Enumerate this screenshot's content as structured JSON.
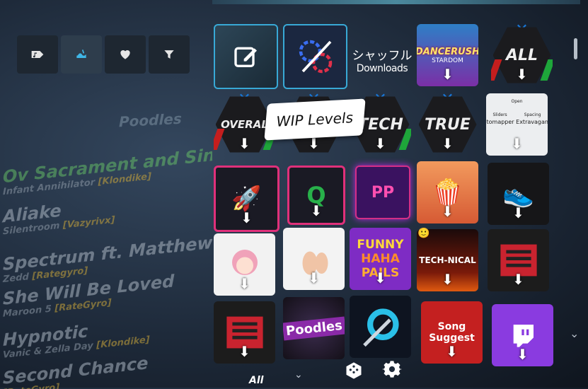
{
  "filter_bar": {
    "buttons": [
      {
        "icon": "music-tag-icon",
        "selected": false
      },
      {
        "icon": "ost-wave-icon",
        "selected": true
      },
      {
        "icon": "heart-icon",
        "selected": false
      },
      {
        "icon": "filter-icon",
        "selected": false
      }
    ]
  },
  "background_list": {
    "pack_title": "Poodles",
    "songs": [
      {
        "title": "Ov Sacrament and Sincest (f",
        "artist": "Infant Annihilator",
        "mapper": "[Klondike]",
        "highlight": true
      },
      {
        "title": "Aliake",
        "artist": "Silentroom",
        "mapper": "[Vazyrivx]"
      },
      {
        "title": "Spectrum ft. Matthew Koma",
        "artist": "Zedd",
        "mapper": "[Rategyro]"
      },
      {
        "title": "She Will Be Loved",
        "artist": "Maroon 5",
        "mapper": "[RateGyro]"
      },
      {
        "title": "Hypnotic",
        "artist": "Vanic & Zella Day",
        "mapper": "[Klondike]"
      },
      {
        "title": "Second Chance",
        "artist": "",
        "mapper": "[RateGyro]"
      }
    ]
  },
  "shuffle": {
    "jp": "シャッフル",
    "en": "Downloads"
  },
  "tooltip": "WIP Levels",
  "tiles": {
    "dancerush": {
      "line1": "DANCERUSH",
      "line2": "STARDOM"
    },
    "all": "ALL",
    "overall": "OVERAL",
    "tech": "TECH",
    "true": "TRUE",
    "automapper": {
      "top": "Open",
      "left": "Sliders",
      "right": "Spacing",
      "main1": "Automapper",
      "main2": "Extravaganza"
    },
    "pp": "PP",
    "funny": {
      "l1": "FUNNY",
      "l2": "HAHA",
      "l3": "PAILS"
    },
    "technical": "TECH-NICAL",
    "poodles": "Poodles",
    "song_suggest": {
      "l1": "Song",
      "l2": "Suggest"
    }
  },
  "bottom": {
    "category": "All"
  }
}
